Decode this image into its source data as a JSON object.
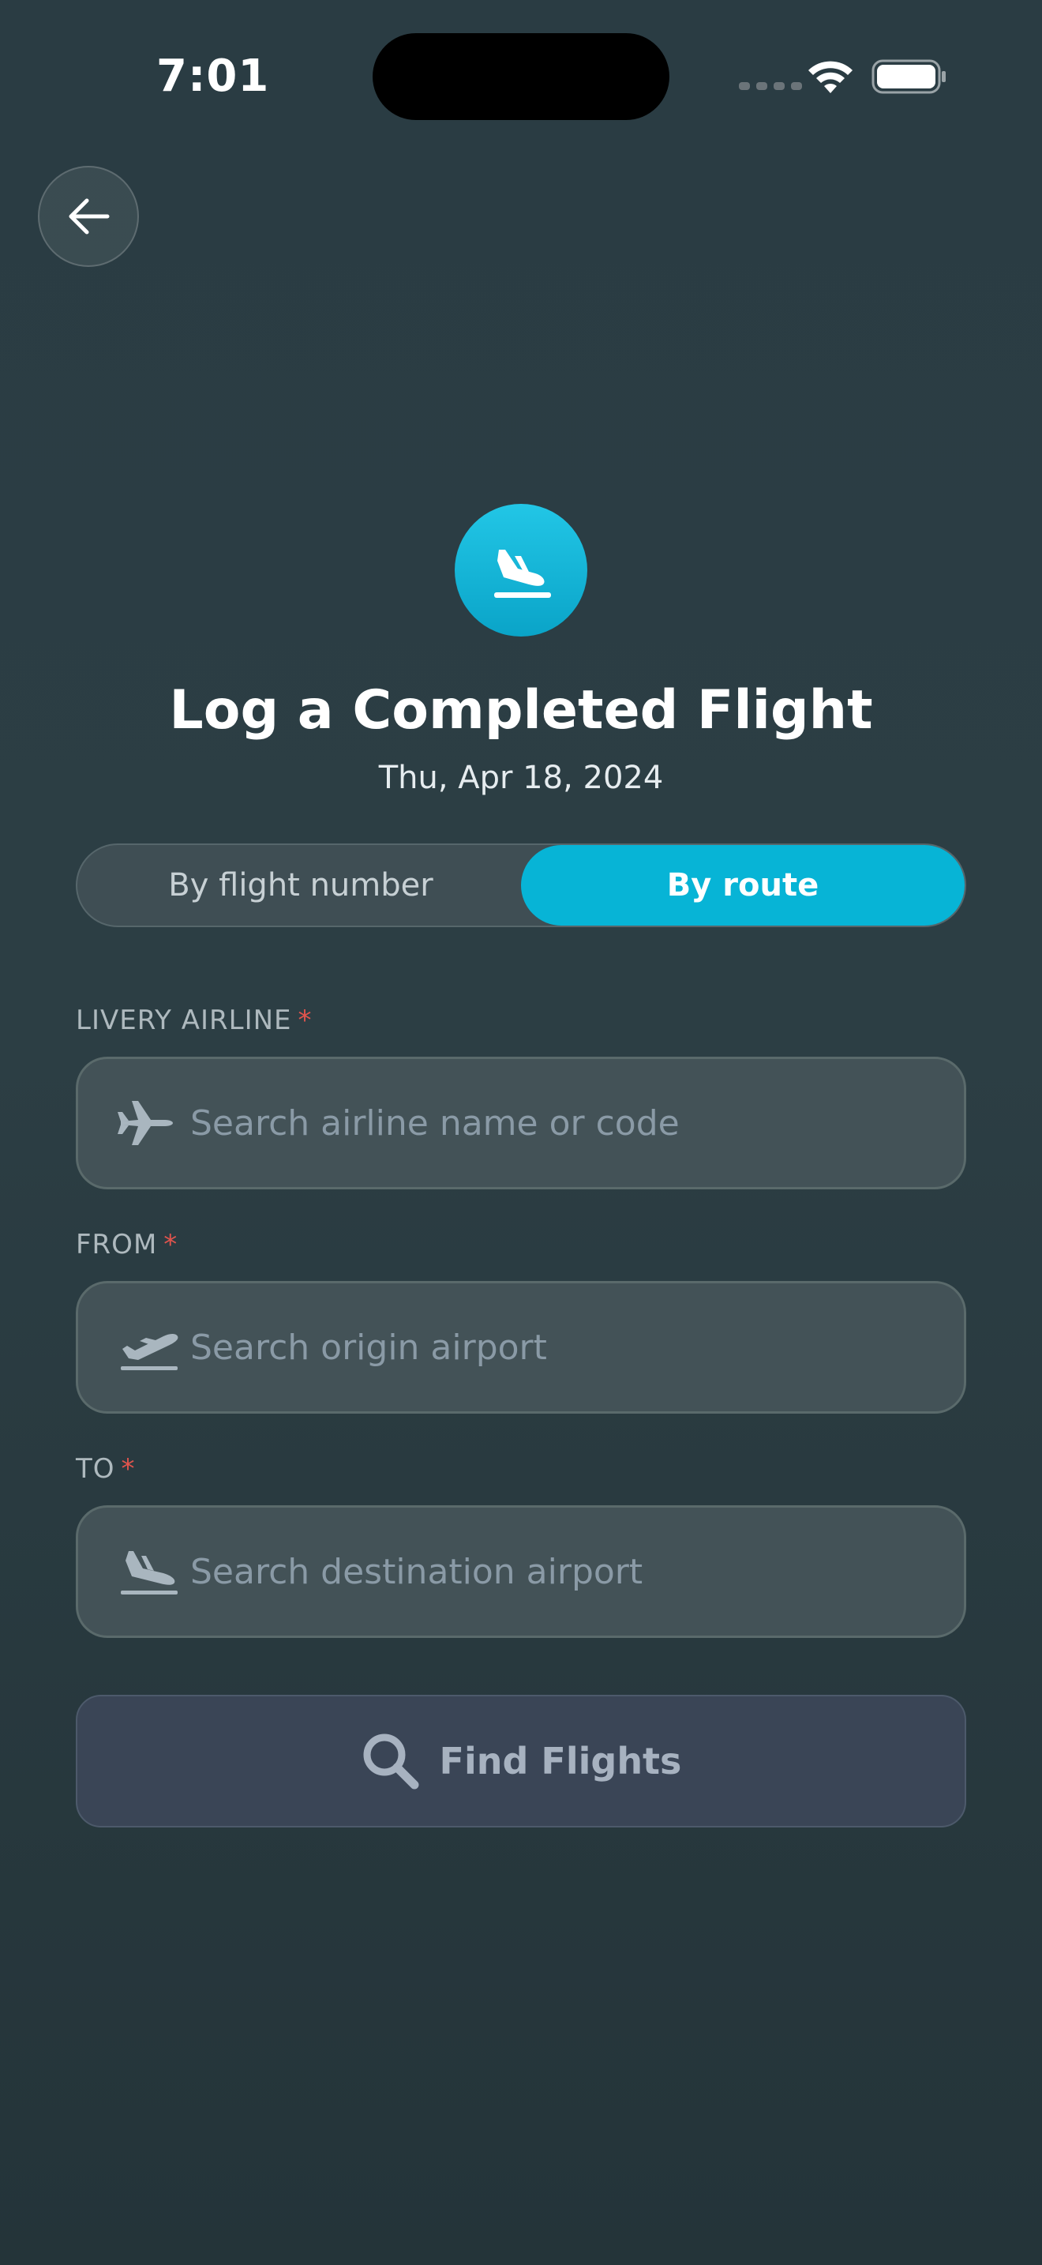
{
  "status_bar": {
    "time": "7:01"
  },
  "header": {
    "title": "Log a Completed Flight",
    "date": "Thu, Apr 18, 2024"
  },
  "mode_toggle": {
    "options": [
      "By flight number",
      "By route"
    ],
    "selected": "By route"
  },
  "form": {
    "airline": {
      "label": "LIVERY AIRLINE",
      "required_mark": "*",
      "placeholder": "Search airline name or code",
      "value": "",
      "icon": "airplane-icon"
    },
    "from": {
      "label": "FROM",
      "required_mark": "*",
      "placeholder": "Search origin airport",
      "value": "",
      "icon": "takeoff-icon"
    },
    "to": {
      "label": "TO",
      "required_mark": "*",
      "placeholder": "Search destination airport",
      "value": "",
      "icon": "landing-icon"
    },
    "submit_label": "Find Flights"
  },
  "colors": {
    "accent": "#07b4d6",
    "background": "#2c3e44",
    "required": "#e0544d",
    "button_disabled": "#3a4556"
  }
}
